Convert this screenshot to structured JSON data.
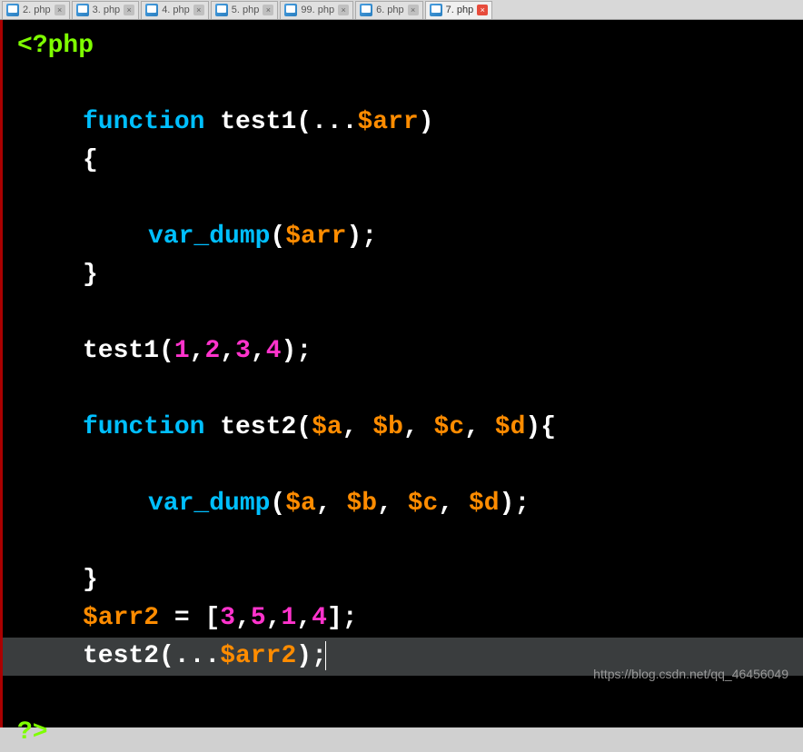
{
  "tabs": [
    {
      "label": "2. php",
      "active": false
    },
    {
      "label": "3. php",
      "active": false
    },
    {
      "label": "4. php",
      "active": false
    },
    {
      "label": "5. php",
      "active": false
    },
    {
      "label": "99. php",
      "active": false
    },
    {
      "label": "6. php",
      "active": false
    },
    {
      "label": "7. php",
      "active": true
    }
  ],
  "code": {
    "open_tag": "<?php",
    "close_tag": "?>",
    "kw_function": "function",
    "func_test1": "test1",
    "func_test2": "test2",
    "builtin_var_dump": "var_dump",
    "var_arr": "$arr",
    "var_arr2": "$arr2",
    "var_a": "$a",
    "var_b": "$b",
    "var_c": "$c",
    "var_d": "$d",
    "spread": "...",
    "n1": "1",
    "n2": "2",
    "n3": "3",
    "n4": "4",
    "n5": "5",
    "eq": "=",
    "lb": "[",
    "rb": "]",
    "lp": "(",
    "rp": ")",
    "ob": "{",
    "cb": "}",
    "semi": ";",
    "comma": ","
  },
  "watermark": "https://blog.csdn.net/qq_46456049"
}
